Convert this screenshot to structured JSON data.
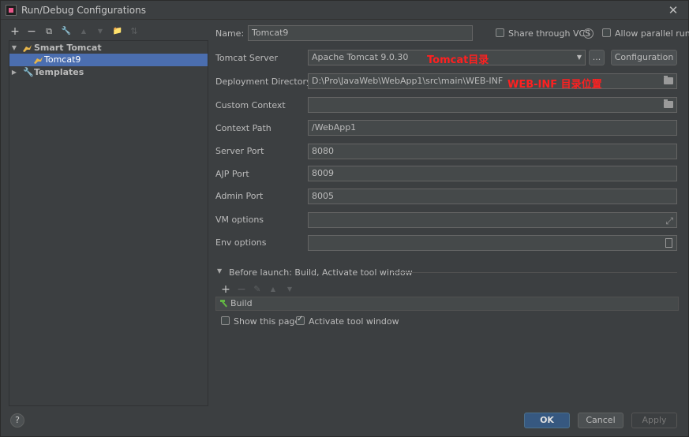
{
  "window": {
    "title": "Run/Debug Configurations",
    "close_glyph": "✕"
  },
  "left_toolbar": {
    "add": "+",
    "remove": "−",
    "copy": "⧉",
    "wrench": "🔧",
    "up": "▲",
    "down": "▼",
    "folder": "📁",
    "sort": "⇅"
  },
  "tree": {
    "items": [
      {
        "label": "Smart Tomcat",
        "expanded": true
      },
      {
        "label": "Tomcat9",
        "selected": true
      },
      {
        "label": "Templates",
        "expanded": false
      }
    ]
  },
  "form": {
    "name_label": "Name:",
    "name_value": "Tomcat9",
    "share_vcs": "Share through VCS",
    "allow_parallel": "Allow parallel run",
    "tomcat_server_label": "Tomcat Server",
    "tomcat_server_value": "Apache Tomcat 9.0.30",
    "ellipsis": "...",
    "configuration_button": "Configuration",
    "deployment_label": "Deployment Directory",
    "deployment_value": "D:\\Pro\\JavaWeb\\WebApp1\\src\\main\\WEB-INF",
    "custom_context_label": "Custom Context",
    "custom_context_value": "",
    "context_path_label": "Context Path",
    "context_path_value": "/WebApp1",
    "server_port_label": "Server Port",
    "server_port_value": "8080",
    "ajp_port_label": "AJP Port",
    "ajp_port_value": "8009",
    "admin_port_label": "Admin Port",
    "admin_port_value": "8005",
    "vm_options_label": "VM options",
    "vm_options_value": "",
    "env_options_label": "Env options",
    "env_options_value": ""
  },
  "annotations": {
    "tomcat_dir": "Tomcat目录",
    "webinf_dir": "WEB-INF 目录位置"
  },
  "before_launch": {
    "header": "Before launch: Build, Activate tool window",
    "toolbar": {
      "add": "+",
      "remove": "−",
      "edit": "✎",
      "up": "▲",
      "down": "▼"
    },
    "tasks": [
      "Build"
    ],
    "show_this_page": "Show this page",
    "show_this_page_checked": false,
    "activate_tool_window": "Activate tool window",
    "activate_tool_window_checked": true
  },
  "footer": {
    "help": "?",
    "ok": "OK",
    "cancel": "Cancel",
    "apply": "Apply"
  },
  "colors": {
    "background": "#3c3f41",
    "selection": "#4b6eaf",
    "annotation": "#ff2020",
    "ok_button": "#365880"
  }
}
